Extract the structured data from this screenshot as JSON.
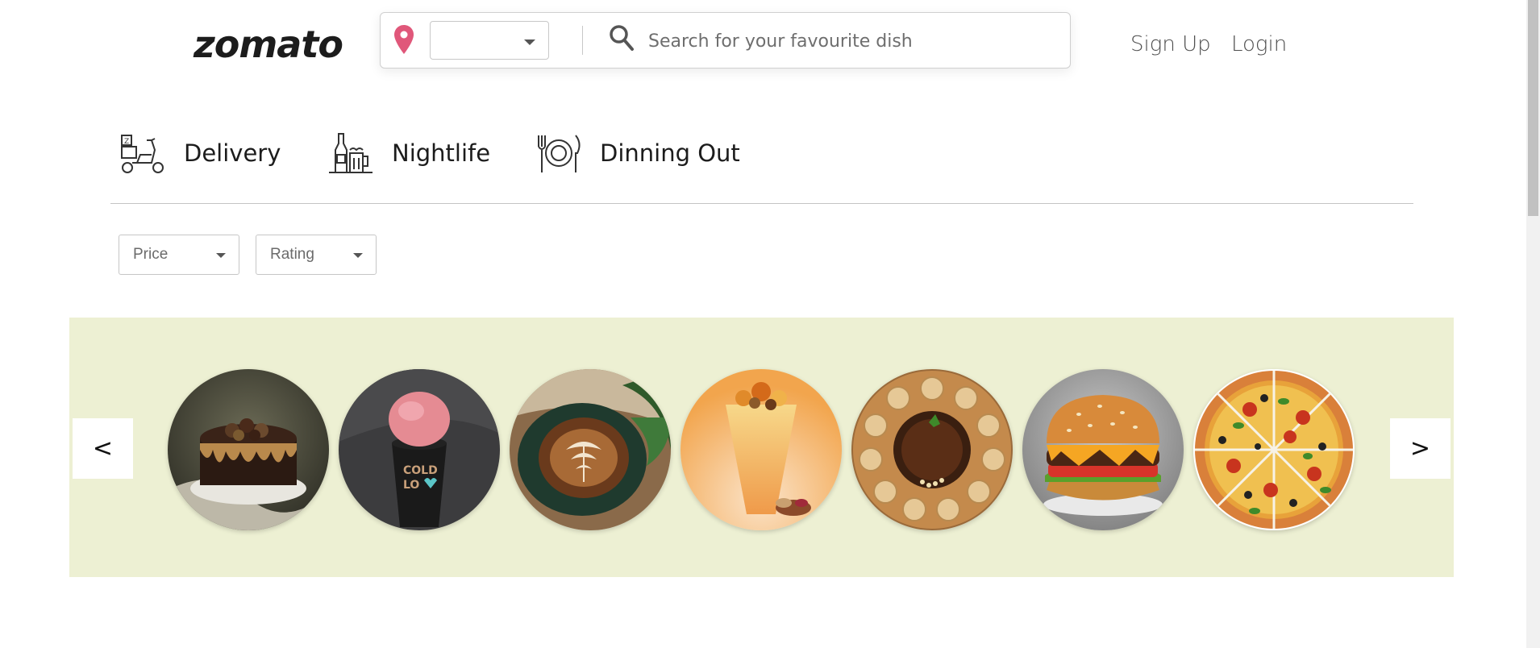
{
  "header": {
    "logo": "zomato",
    "location_select_value": "",
    "search_placeholder": "Search for your favourite dish",
    "signup_label": "Sign Up",
    "login_label": "Login"
  },
  "tabs": [
    {
      "label": "Delivery",
      "icon": "scooter-icon"
    },
    {
      "label": "Nightlife",
      "icon": "bottle-glass-icon"
    },
    {
      "label": "Dinning Out",
      "icon": "plate-cutlery-icon"
    }
  ],
  "filters": {
    "price_label": "Price",
    "rating_label": "Rating"
  },
  "carousel": {
    "prev_label": "<",
    "next_label": ">",
    "items": [
      {
        "name": "chocolate-cake"
      },
      {
        "name": "ice-cream-cup"
      },
      {
        "name": "coffee-latte"
      },
      {
        "name": "mango-shake"
      },
      {
        "name": "pani-puri"
      },
      {
        "name": "burger"
      },
      {
        "name": "pizza"
      }
    ]
  },
  "colors": {
    "pin": "#e0577a",
    "carousel_bg": "#edf0d3",
    "text_dark": "#1c1c1c"
  }
}
